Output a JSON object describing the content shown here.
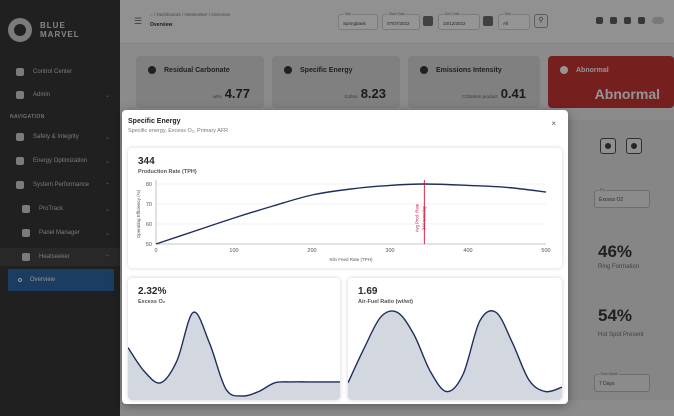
{
  "brand": {
    "line1": "BLUE",
    "line2": "MARVEL"
  },
  "sidebar": {
    "items": [
      {
        "label": "Control Center"
      },
      {
        "label": "Admin"
      }
    ],
    "section_heading": "NAVIGATION",
    "nav": [
      {
        "label": "Safety & Integrity"
      },
      {
        "label": "Energy Optimization"
      },
      {
        "label": "System Performance"
      },
      {
        "label": "ProTrack"
      },
      {
        "label": "Panel Manager"
      },
      {
        "label": "Heatseeker"
      },
      {
        "label": "Overview"
      }
    ]
  },
  "topbar": {
    "breadcrumb": "⌂ / Dashboards / Heatseeker / Overview",
    "title": "Overview",
    "site": {
      "label": "Site",
      "value": "Springbank"
    },
    "start_date": {
      "label": "Start Date",
      "value": "07/07/2022"
    },
    "end_date": {
      "label": "End Date",
      "value": "10/12/2022"
    },
    "kiln": {
      "label": "Kiln",
      "value": "All"
    }
  },
  "kpis": [
    {
      "title": "Residual Carbonate",
      "unit": "wt%",
      "value": "4.77"
    },
    {
      "title": "Specific Energy",
      "unit": "GJ/ton",
      "value": "8.23"
    },
    {
      "title": "Emissions Intensity",
      "unit": "CO2e/ton product",
      "value": "0.41"
    },
    {
      "title": "Abnormal",
      "unit": "",
      "value": "Abnormal"
    }
  ],
  "background_right": {
    "field1": {
      "label": "PV",
      "value": "Excess O2"
    },
    "pct1": {
      "value": "46%",
      "label": "Ring Formation"
    },
    "pct2": {
      "value": "54%",
      "label": "Hot Spot Present"
    },
    "field2": {
      "label": "Time frame",
      "value": "7 Days"
    }
  },
  "modal": {
    "title": "Specific Energy",
    "subtitle": "Specific energy, Excess O₂, Primary AFR",
    "close": "×",
    "main_chart": {
      "value": "344",
      "label": "Production Rate (TPH)"
    },
    "panel_left": {
      "value": "2.32%",
      "label": "Excess O₂"
    },
    "panel_right": {
      "value": "1.69",
      "label": "Air-Fuel Ratio (wt/wt)"
    }
  },
  "chart_data": [
    {
      "type": "line",
      "title": "Production Rate (TPH)",
      "xlabel": "Kiln Feed Rate (TPH)",
      "ylabel": "Operating Efficiency (%)",
      "xlim": [
        0,
        500
      ],
      "ylim": [
        50,
        80
      ],
      "xticks": [
        0,
        100,
        200,
        300,
        400,
        500
      ],
      "yticks": [
        50,
        60,
        70,
        80
      ],
      "x": [
        0,
        50,
        100,
        150,
        200,
        250,
        300,
        344,
        400,
        450,
        500
      ],
      "y": [
        50,
        56.5,
        63,
        69,
        74.5,
        77.5,
        79.3,
        80,
        79.3,
        78.3,
        76
      ],
      "annotations": [
        {
          "x": 344,
          "lines": [
            "Avg Prod. Rate",
            "344 tons/day"
          ]
        }
      ],
      "grid": true
    },
    {
      "type": "area",
      "title": "Excess O₂",
      "x": [
        0,
        1,
        2,
        3,
        4,
        5,
        6,
        7,
        8,
        9,
        10,
        11,
        12,
        13
      ],
      "y": [
        0.55,
        0.28,
        0.15,
        0.4,
        0.95,
        0.6,
        0.08,
        0.0,
        0.05,
        0.15,
        0.16,
        0.16,
        0.16,
        0.16
      ]
    },
    {
      "type": "area",
      "title": "Air-Fuel Ratio (wt/wt)",
      "x": [
        0,
        1,
        2,
        3,
        4,
        5,
        6,
        7,
        8,
        9,
        10,
        11,
        12,
        13
      ],
      "y": [
        0.15,
        0.55,
        0.9,
        0.95,
        0.7,
        0.28,
        0.05,
        0.25,
        0.85,
        0.95,
        0.6,
        0.18,
        0.05,
        0.1
      ]
    }
  ]
}
